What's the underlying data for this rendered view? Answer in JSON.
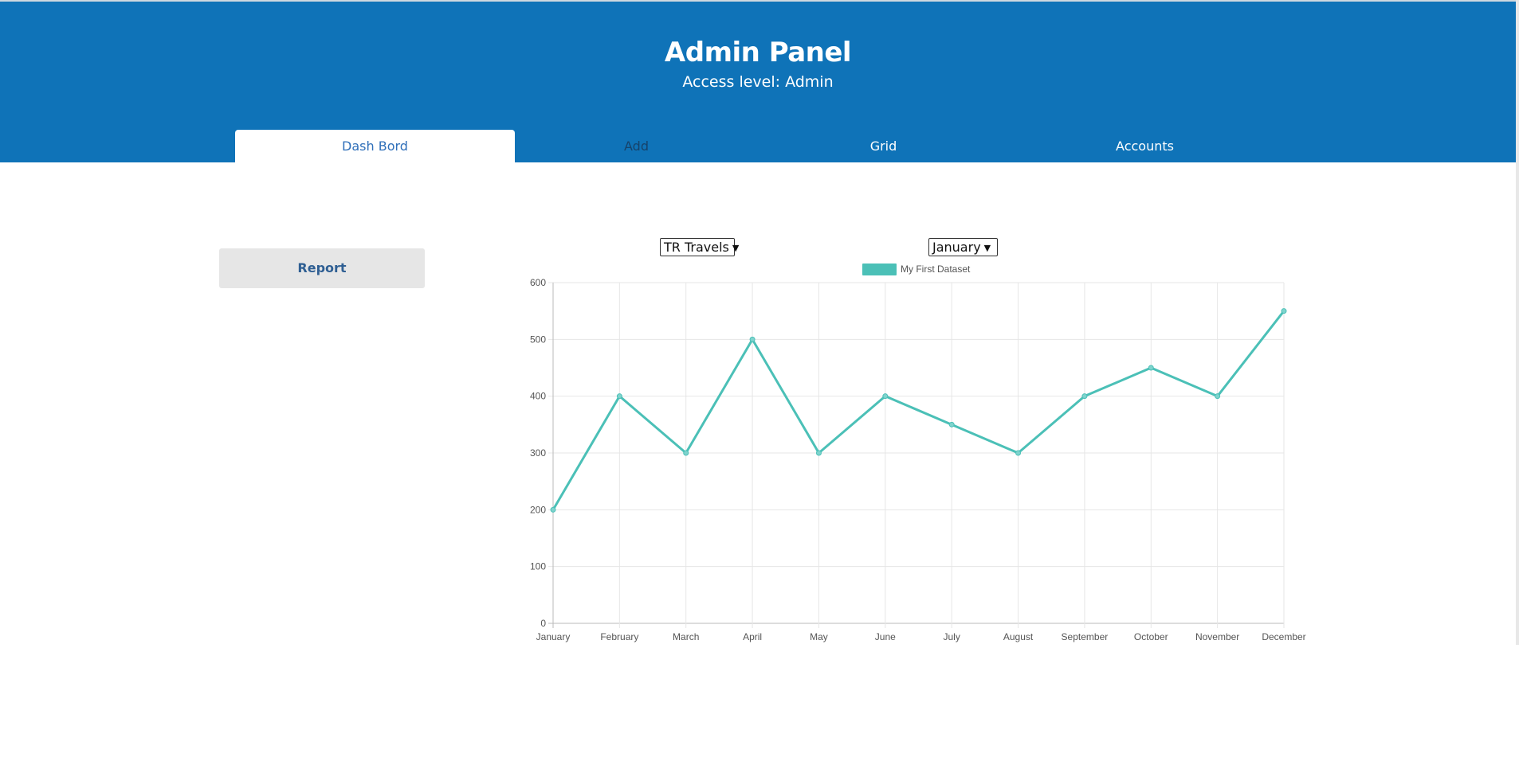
{
  "header": {
    "title": "Admin Panel",
    "subtitle": "Access level: Admin",
    "color": "#0f73b8"
  },
  "tabs": [
    {
      "label": "Dash Bord",
      "state": "active"
    },
    {
      "label": "Add",
      "state": "dim"
    },
    {
      "label": "Grid",
      "state": "inactive"
    },
    {
      "label": "Accounts",
      "state": "inactive"
    }
  ],
  "sidebar": {
    "report_label": "Report"
  },
  "filters": {
    "company_value": "TR Travels",
    "month_value": "January"
  },
  "chart_data": {
    "type": "line",
    "categories": [
      "January",
      "February",
      "March",
      "April",
      "May",
      "June",
      "July",
      "August",
      "September",
      "October",
      "November",
      "December"
    ],
    "series": [
      {
        "name": "My First Dataset",
        "values": [
          200,
          400,
          300,
          500,
          300,
          400,
          350,
          300,
          400,
          450,
          400,
          550
        ],
        "color": "#4bc0b7"
      }
    ],
    "ylim": [
      0,
      600
    ],
    "yticks": [
      0,
      100,
      200,
      300,
      400,
      500,
      600
    ],
    "grid": true,
    "legend": "top"
  }
}
